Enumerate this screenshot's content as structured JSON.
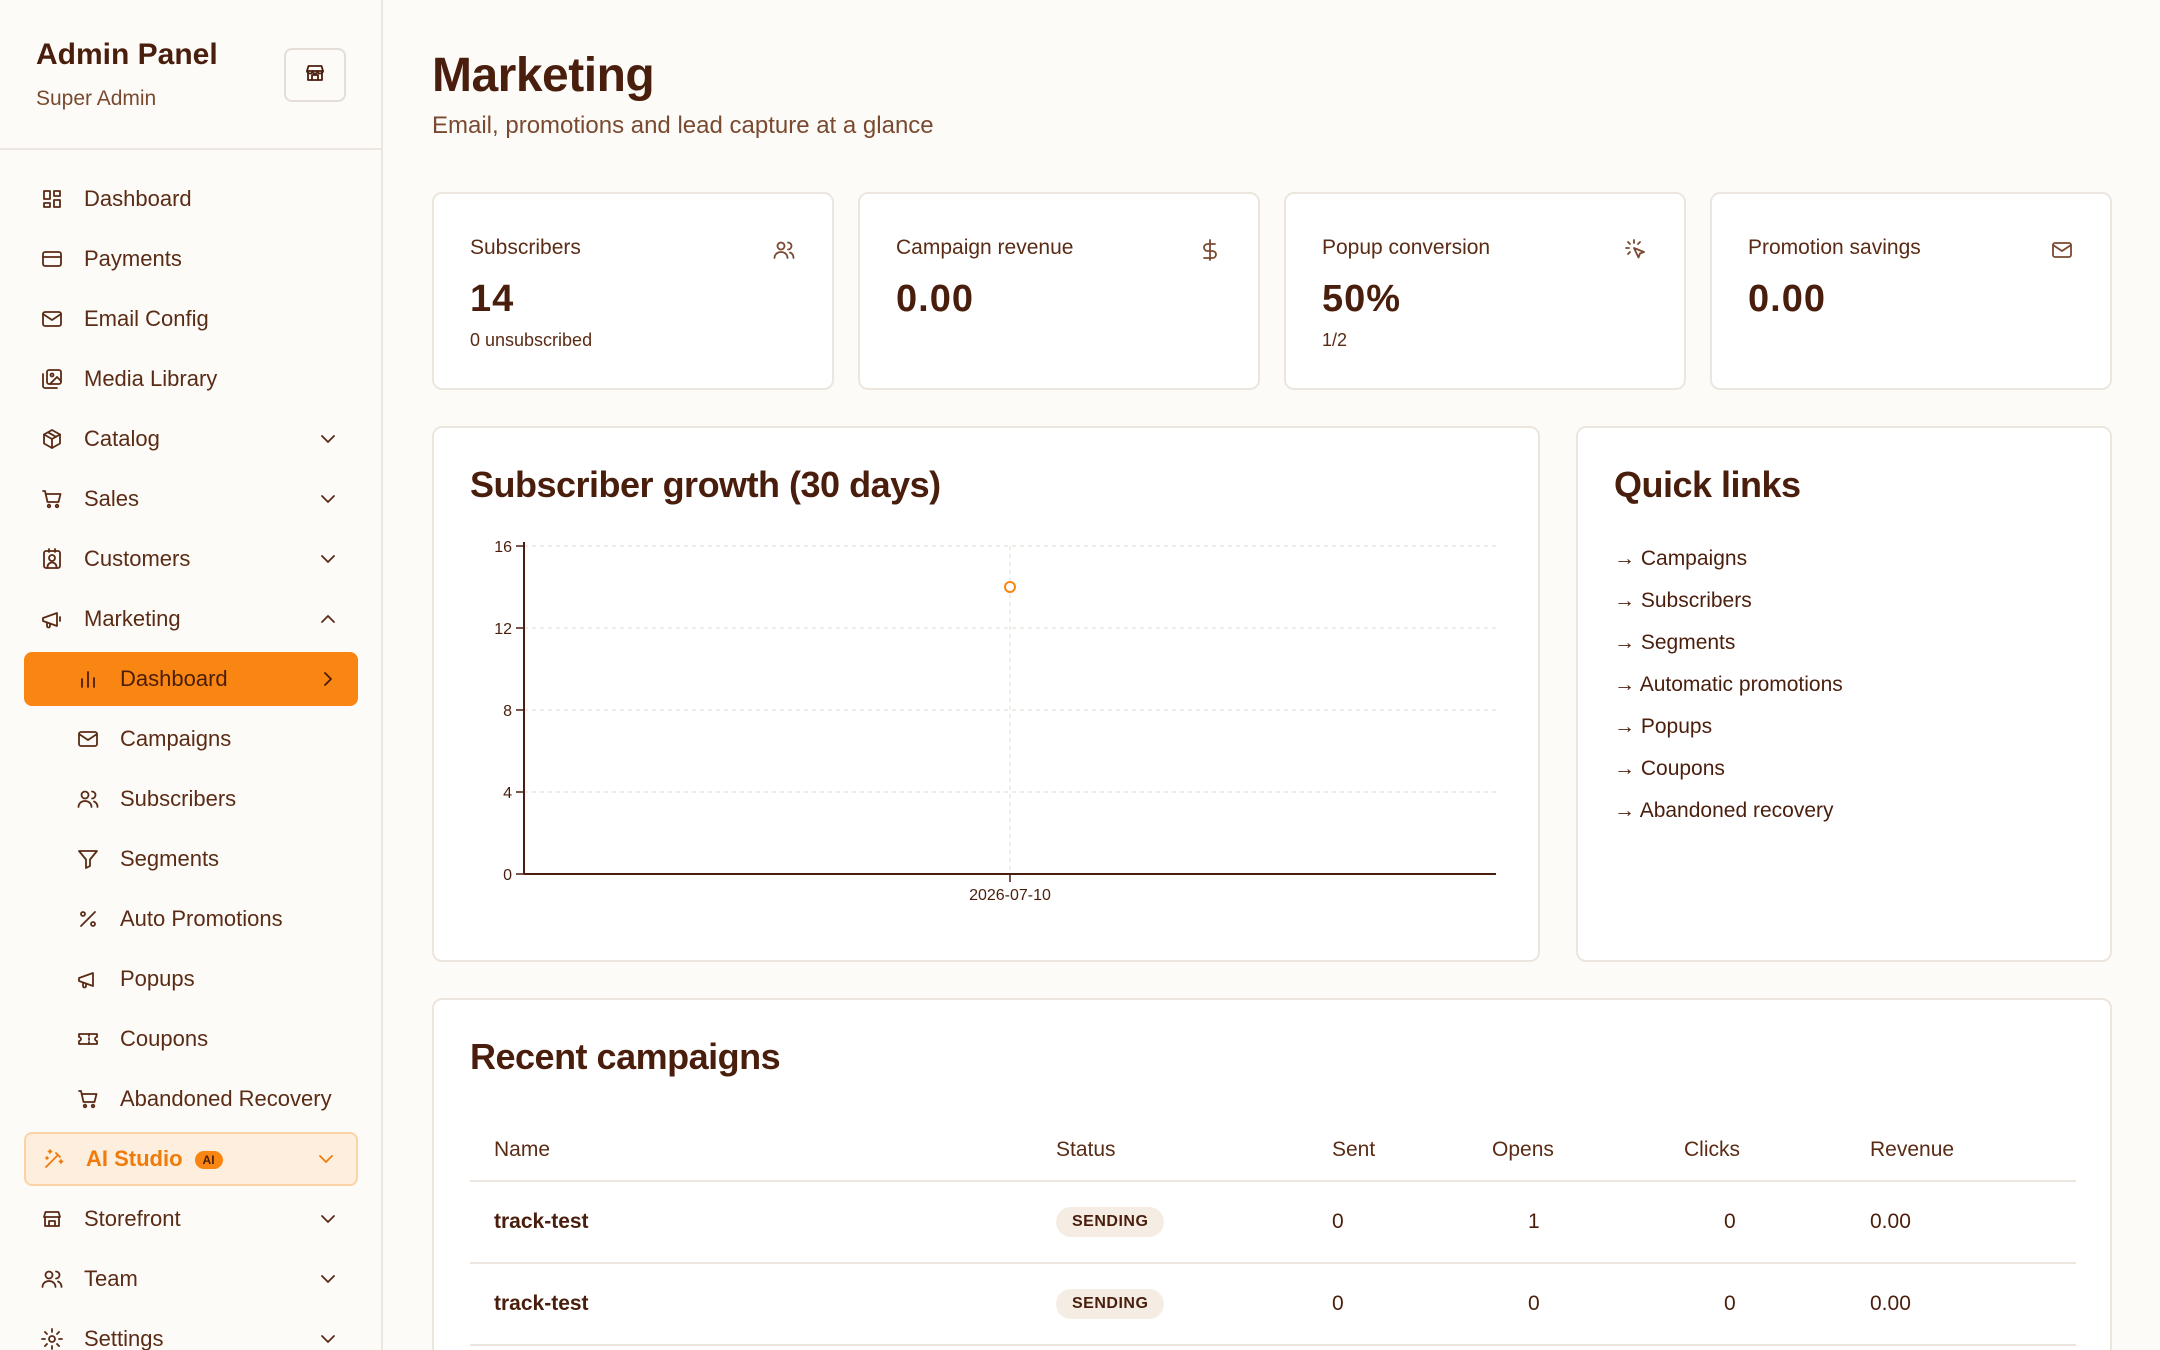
{
  "sidebar": {
    "title": "Admin Panel",
    "subtitle": "Super Admin",
    "items": [
      {
        "label": "Dashboard"
      },
      {
        "label": "Payments"
      },
      {
        "label": "Email Config"
      },
      {
        "label": "Media Library"
      },
      {
        "label": "Catalog"
      },
      {
        "label": "Sales"
      },
      {
        "label": "Customers"
      },
      {
        "label": "Marketing"
      },
      {
        "label": "Dashboard"
      },
      {
        "label": "Campaigns"
      },
      {
        "label": "Subscribers"
      },
      {
        "label": "Segments"
      },
      {
        "label": "Auto Promotions"
      },
      {
        "label": "Popups"
      },
      {
        "label": "Coupons"
      },
      {
        "label": "Abandoned Recovery"
      },
      {
        "label": "AI Studio",
        "badge": "AI"
      },
      {
        "label": "Storefront"
      },
      {
        "label": "Team"
      },
      {
        "label": "Settings"
      }
    ]
  },
  "header": {
    "title": "Marketing",
    "subtitle": "Email, promotions and lead capture at a glance"
  },
  "stats": [
    {
      "label": "Subscribers",
      "value": "14",
      "note": "0 unsubscribed",
      "icon": "users-icon"
    },
    {
      "label": "Campaign revenue",
      "value": "0.00",
      "note": "",
      "icon": "dollar-icon"
    },
    {
      "label": "Popup conversion",
      "value": "50%",
      "note": "1/2",
      "icon": "cursor-click-icon"
    },
    {
      "label": "Promotion savings",
      "value": "0.00",
      "note": "",
      "icon": "mail-icon"
    }
  ],
  "growth": {
    "title": "Subscriber growth (30 days)"
  },
  "chart_data": {
    "type": "line",
    "title": "Subscriber growth (30 days)",
    "x": [
      "2026-07-10"
    ],
    "series": [
      {
        "values": [
          14
        ]
      }
    ],
    "ylim": [
      0,
      16
    ],
    "yticks": [
      0,
      4,
      8,
      12,
      16
    ],
    "grid": true,
    "color": "#f98512"
  },
  "quick_links": {
    "title": "Quick links",
    "items": [
      "Campaigns",
      "Subscribers",
      "Segments",
      "Automatic promotions",
      "Popups",
      "Coupons",
      "Abandoned recovery"
    ]
  },
  "campaigns": {
    "title": "Recent campaigns",
    "columns": [
      "Name",
      "Status",
      "Sent",
      "Opens",
      "Clicks",
      "Revenue"
    ],
    "rows": [
      {
        "name": "track-test",
        "status": "SENDING",
        "sent": "0",
        "opens": "1",
        "clicks": "0",
        "revenue": "0.00"
      },
      {
        "name": "track-test",
        "status": "SENDING",
        "sent": "0",
        "opens": "0",
        "clicks": "0",
        "revenue": "0.00"
      }
    ]
  },
  "colors": {
    "accent": "#f98512",
    "text": "#4a1e0c"
  }
}
